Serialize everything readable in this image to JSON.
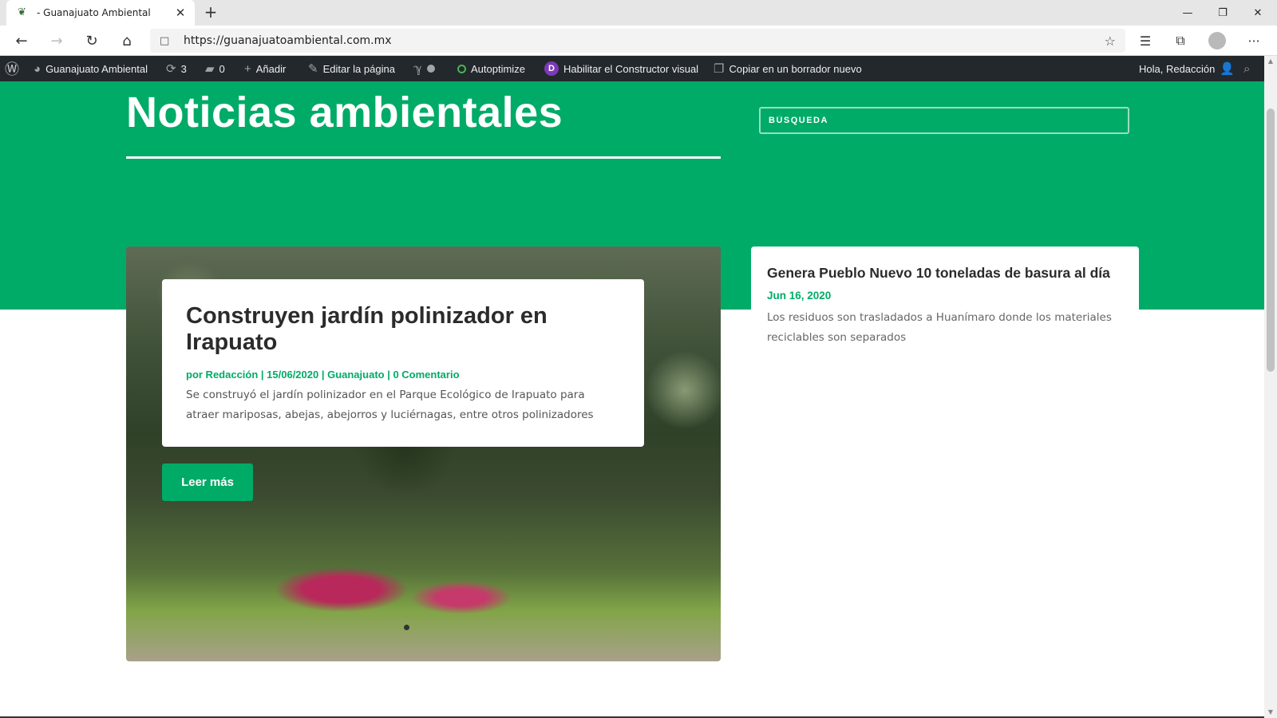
{
  "browser": {
    "tab_title": "- Guanajuato Ambiental",
    "url": "https://guanajuatoambiental.com.mx"
  },
  "icons": {
    "back": "←",
    "forward": "→",
    "reload": "↻",
    "home": "⌂",
    "lock": "🔒",
    "star": "☆",
    "favorites": "☰",
    "collections": "⧉",
    "more": "···",
    "min": "—",
    "restore": "❐",
    "close": "✕",
    "newtab": "+",
    "tabclose": "✕"
  },
  "adminbar": {
    "site_name": "Guanajuato Ambiental",
    "updates_count": "3",
    "comments_count": "0",
    "add_label": "Añadir",
    "edit_label": "Editar la página",
    "autoptimize_label": "Autoptimize",
    "visual_builder_label": "Habilitar el Constructor visual",
    "copy_label": "Copiar en un borrador nuevo",
    "greeting": "Hola, Redacción"
  },
  "page": {
    "title": "Noticias ambientales",
    "search_placeholder": "BÚSQUEDA"
  },
  "featured_post": {
    "title": "Construyen jardín polinizador en Irapuato",
    "meta": "por Redacción | 15/06/2020 | Guanajuato | 0 Comentario",
    "excerpt": "Se construyó el jardín polinizador en el Parque Ecológico de Irapuato para atraer mariposas, abejas, abejorros y luciérnagas, entre otros polinizadores",
    "button_label": "Leer más"
  },
  "side_post": {
    "title": "Genera Pueblo Nuevo 10 toneladas de basura al día",
    "date": "Jun 16, 2020",
    "excerpt": "Los residuos son trasladados a Huanímaro donde los materiales reciclables son separados"
  },
  "colors": {
    "brand_green": "#00ab67",
    "admin_bar": "#23282d"
  }
}
